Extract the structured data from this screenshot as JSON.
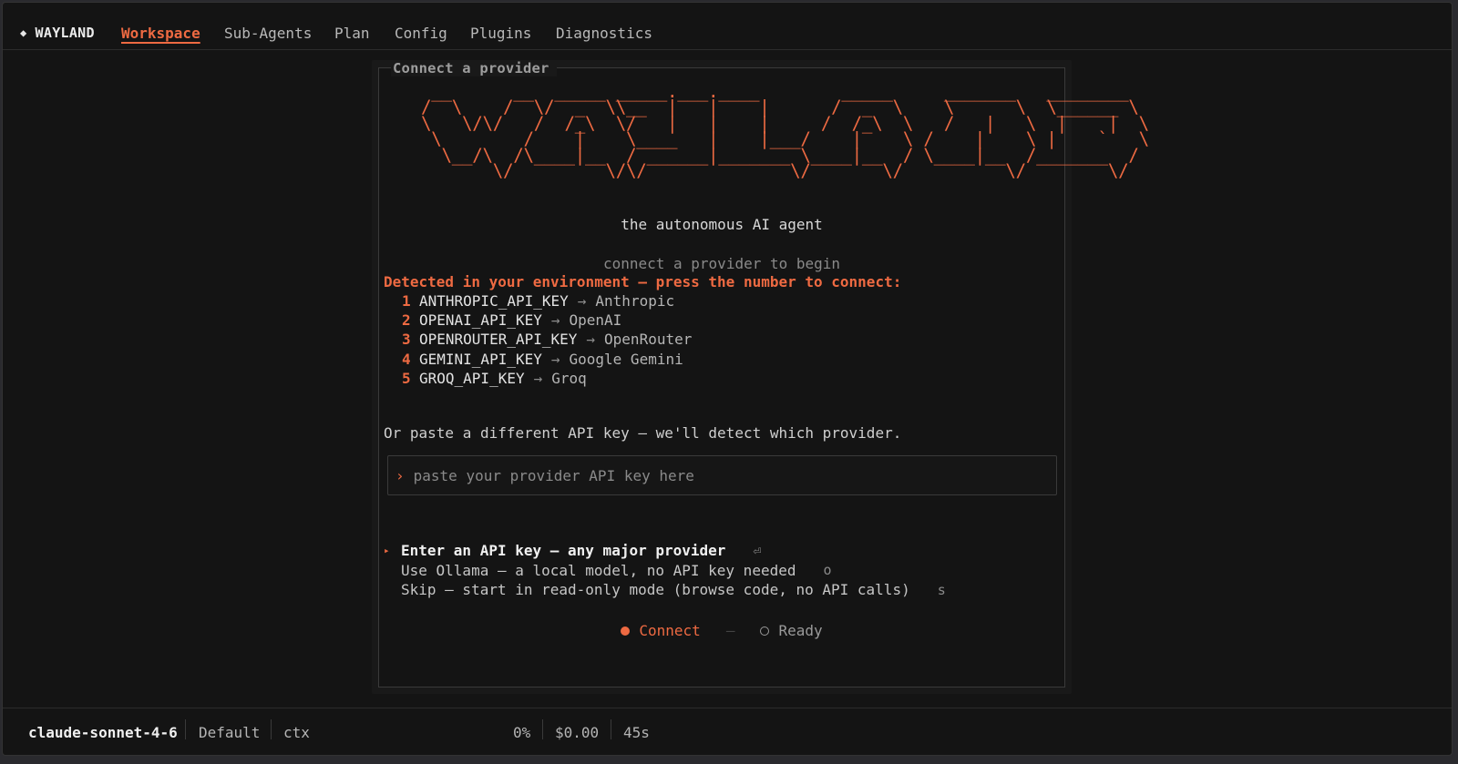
{
  "app": {
    "brand_icon": "diamond-icon",
    "brand_name": "WAYLAND",
    "accent_color": "#ee6a42"
  },
  "nav": {
    "tabs": [
      {
        "label": "Workspace",
        "active": true
      },
      {
        "label": "Sub-Agents",
        "active": false
      },
      {
        "label": "Plan",
        "active": false
      },
      {
        "label": "Config",
        "active": false
      },
      {
        "label": "Plugins",
        "active": false
      },
      {
        "label": "Diagnostics",
        "active": false
      }
    ]
  },
  "panel": {
    "title": "Connect a provider",
    "ascii_logo": " __      __  _____ _____.___.____        _____     _______   ________\n/  \\    /  \\/  _  \\\\__  |   |    |      /  _  \\    \\      \\  \\______ \\\n\\   \\/\\/   /  /_\\  \\/   |   |    |     /  /_\\  \\   /   |   \\  |    |  \\\n \\        /    |    \\____   |    |___/    |    \\ /    |    \\ |    `   \\\n  \\__/\\  /\\____|__  / ______|_______ \\____|__  / \\____|__  /_______  /\n       \\/         \\/\\/              \\/       \\/          \\/        \\/",
    "tagline": "the autonomous AI agent",
    "subtagline": "connect a provider to begin",
    "detected_heading": "Detected in your environment — press the number to connect:",
    "env_keys": [
      {
        "num": "1",
        "key": "ANTHROPIC_API_KEY",
        "arrow": "→",
        "provider": "Anthropic"
      },
      {
        "num": "2",
        "key": "OPENAI_API_KEY",
        "arrow": "→",
        "provider": "OpenAI"
      },
      {
        "num": "3",
        "key": "OPENROUTER_API_KEY",
        "arrow": "→",
        "provider": "OpenRouter"
      },
      {
        "num": "4",
        "key": "GEMINI_API_KEY",
        "arrow": "→",
        "provider": "Google Gemini"
      },
      {
        "num": "5",
        "key": "GROQ_API_KEY",
        "arrow": "→",
        "provider": "Groq"
      }
    ],
    "paste_prompt": "Or paste a different API key — we'll detect which provider.",
    "input": {
      "prompt_glyph": "›",
      "value": "",
      "placeholder": "paste your provider API key here"
    },
    "options": [
      {
        "marker": "▸",
        "label": "Enter an API key — any major provider",
        "hint": "⏎",
        "selected": true
      },
      {
        "marker": "",
        "label": "Use Ollama — a local model, no API key needed",
        "hint": "o",
        "selected": false
      },
      {
        "marker": "",
        "label": "Skip — start in read-only mode (browse code, no API calls)",
        "hint": "s",
        "selected": false
      }
    ],
    "steps": [
      {
        "label": "Connect",
        "state": "active"
      },
      {
        "separator": "—"
      },
      {
        "label": "Ready",
        "state": "pending"
      }
    ]
  },
  "statusbar": {
    "model": "claude-sonnet-4-6",
    "mode": "Default",
    "ctx_label": "ctx",
    "ctx_percent": "0%",
    "cost": "$0.00",
    "elapsed": "45s"
  }
}
